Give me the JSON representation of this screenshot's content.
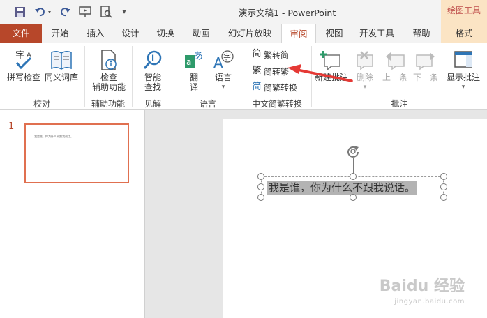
{
  "title_bar": {
    "title": "演示文稿1  -  PowerPoint",
    "context_group": "绘图工具",
    "qat": {
      "save": "save-icon",
      "undo": "undo-icon",
      "redo": "redo-icon",
      "present": "present-from-start-icon",
      "preview": "print-preview-icon",
      "customize": "customize-qat-icon"
    }
  },
  "tabs": [
    {
      "label": "文件"
    },
    {
      "label": "开始"
    },
    {
      "label": "插入"
    },
    {
      "label": "设计"
    },
    {
      "label": "切换"
    },
    {
      "label": "动画"
    },
    {
      "label": "幻灯片放映"
    },
    {
      "label": "审阅"
    },
    {
      "label": "视图"
    },
    {
      "label": "开发工具"
    },
    {
      "label": "帮助"
    },
    {
      "label": "格式"
    }
  ],
  "ribbon": {
    "proofing": {
      "spell_label": "拼写检查",
      "thesaurus_label": "同义词库",
      "group_label": "校对"
    },
    "accessibility": {
      "check_label": "检查\n辅助功能",
      "group_label": "辅助功能"
    },
    "insights": {
      "smart_lookup_label": "智能\n查找",
      "group_label": "见解"
    },
    "language": {
      "translate_label": "翻\n译",
      "language_label": "语言",
      "group_label": "语言"
    },
    "chinese_conversion": {
      "trad_to_simp_label": "繁转简",
      "simp_to_trad_label": "简转繁",
      "convert_label": "简繁转换",
      "group_label": "中文简繁转换"
    },
    "comments": {
      "new_label": "新建批注",
      "delete_label": "删除",
      "prev_label": "上一条",
      "next_label": "下一条",
      "show_label": "显示批注",
      "group_label": "批注"
    }
  },
  "slides_pane": {
    "slide_number": "1",
    "thumb_text": "我是谁，你为什么不跟我说话。"
  },
  "slide": {
    "textbox_text": "我是谁，你为什么不跟我说话。"
  },
  "watermark": {
    "main": "Baidu 经验",
    "sub": "jingyan.baidu.com"
  },
  "colors": {
    "accent": "#b7472a",
    "arrow": "#e53935",
    "context_bg": "#fbe4c4"
  }
}
